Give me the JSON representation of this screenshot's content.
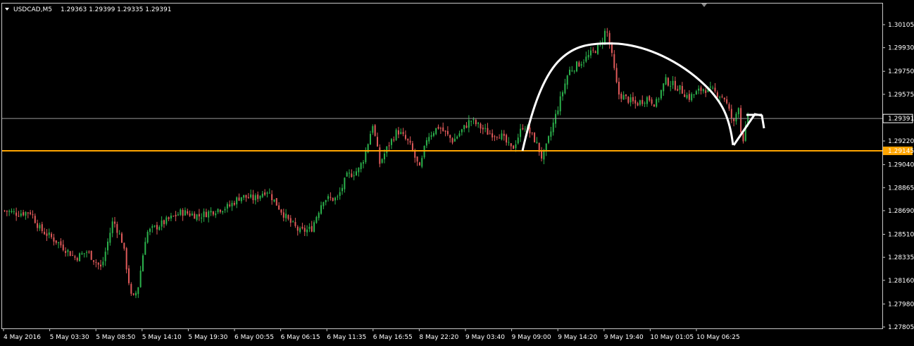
{
  "header": {
    "symbol": "USDCAD,M5",
    "ohlc": "1.29363 1.29399 1.29335 1.29391"
  },
  "colors": {
    "background": "#000000",
    "frame": "#c8c8c8",
    "bull": "#2bb24c",
    "bear": "#e05a5a",
    "support_line": "#ffa500",
    "price_line": "#9a9a9a",
    "text": "#ffffff",
    "drawing": "#ffffff"
  },
  "chart_data": {
    "type": "candlestick",
    "symbol": "USDCAD",
    "timeframe": "M5",
    "ylim": [
      1.27805,
      1.30105
    ],
    "y_ticks": [
      "1.30105",
      "1.29930",
      "1.29750",
      "1.29575",
      "1.29391",
      "1.29220",
      "1.29145",
      "1.29040",
      "1.28865",
      "1.28690",
      "1.28510",
      "1.28335",
      "1.28160",
      "1.27980",
      "1.27805"
    ],
    "x_ticks": [
      "4 May 2016",
      "5 May 03:30",
      "5 May 08:50",
      "5 May 14:10",
      "5 May 19:30",
      "6 May 00:55",
      "6 May 06:15",
      "6 May 11:35",
      "6 May 16:55",
      "8 May 22:20",
      "9 May 03:40",
      "9 May 09:00",
      "9 May 14:20",
      "9 May 19:40",
      "10 May 01:05",
      "10 May 06:25"
    ],
    "num_bars": 318,
    "price_path": [
      [
        0,
        1.2869
      ],
      [
        10,
        1.2867
      ],
      [
        22,
        1.2868
      ],
      [
        30,
        1.2855
      ],
      [
        45,
        1.2845
      ],
      [
        60,
        1.2833
      ],
      [
        70,
        1.2838
      ],
      [
        82,
        1.2825
      ],
      [
        92,
        1.2862
      ],
      [
        100,
        1.2845
      ],
      [
        108,
        1.28
      ],
      [
        113,
        1.281
      ],
      [
        120,
        1.2852
      ],
      [
        135,
        1.286
      ],
      [
        150,
        1.2868
      ],
      [
        165,
        1.2865
      ],
      [
        180,
        1.287
      ],
      [
        190,
        1.2872
      ],
      [
        200,
        1.288
      ],
      [
        212,
        1.2878
      ],
      [
        222,
        1.2885
      ],
      [
        240,
        1.2862
      ],
      [
        250,
        1.2853
      ],
      [
        260,
        1.2855
      ],
      [
        270,
        1.2878
      ],
      [
        282,
        1.2878
      ],
      [
        290,
        1.2895
      ],
      [
        300,
        1.29
      ],
      [
        305,
        1.291
      ],
      [
        312,
        1.2935
      ],
      [
        318,
        1.2905
      ],
      [
        325,
        1.2918
      ],
      [
        333,
        1.293
      ],
      [
        343,
        1.292
      ],
      [
        352,
        1.29
      ],
      [
        358,
        1.2925
      ],
      [
        368,
        1.2933
      ],
      [
        380,
        1.2922
      ],
      [
        395,
        1.2938
      ],
      [
        410,
        1.2928
      ],
      [
        420,
        1.2927
      ],
      [
        430,
        1.2915
      ],
      [
        440,
        1.2935
      ],
      [
        450,
        1.2922
      ],
      [
        456,
        1.2908
      ],
      [
        465,
        1.2935
      ],
      [
        478,
        1.2975
      ],
      [
        493,
        1.2985
      ],
      [
        505,
        1.2995
      ],
      [
        510,
        1.3008
      ],
      [
        515,
        1.2985
      ],
      [
        520,
        1.2958
      ],
      [
        535,
        1.295
      ],
      [
        545,
        1.2955
      ],
      [
        552,
        1.295
      ],
      [
        560,
        1.2968
      ],
      [
        572,
        1.2962
      ],
      [
        580,
        1.2955
      ],
      [
        592,
        1.2962
      ],
      [
        600,
        1.296
      ],
      [
        610,
        1.2955
      ],
      [
        618,
        1.2935
      ],
      [
        622,
        1.295
      ],
      [
        625,
        1.292
      ],
      [
        630,
        1.2939
      ]
    ],
    "horizontal_lines": [
      {
        "price": 1.29145,
        "label": "1.29145",
        "kind": "support"
      },
      {
        "price": 1.29391,
        "label": "1.29391",
        "kind": "current-price"
      }
    ]
  }
}
